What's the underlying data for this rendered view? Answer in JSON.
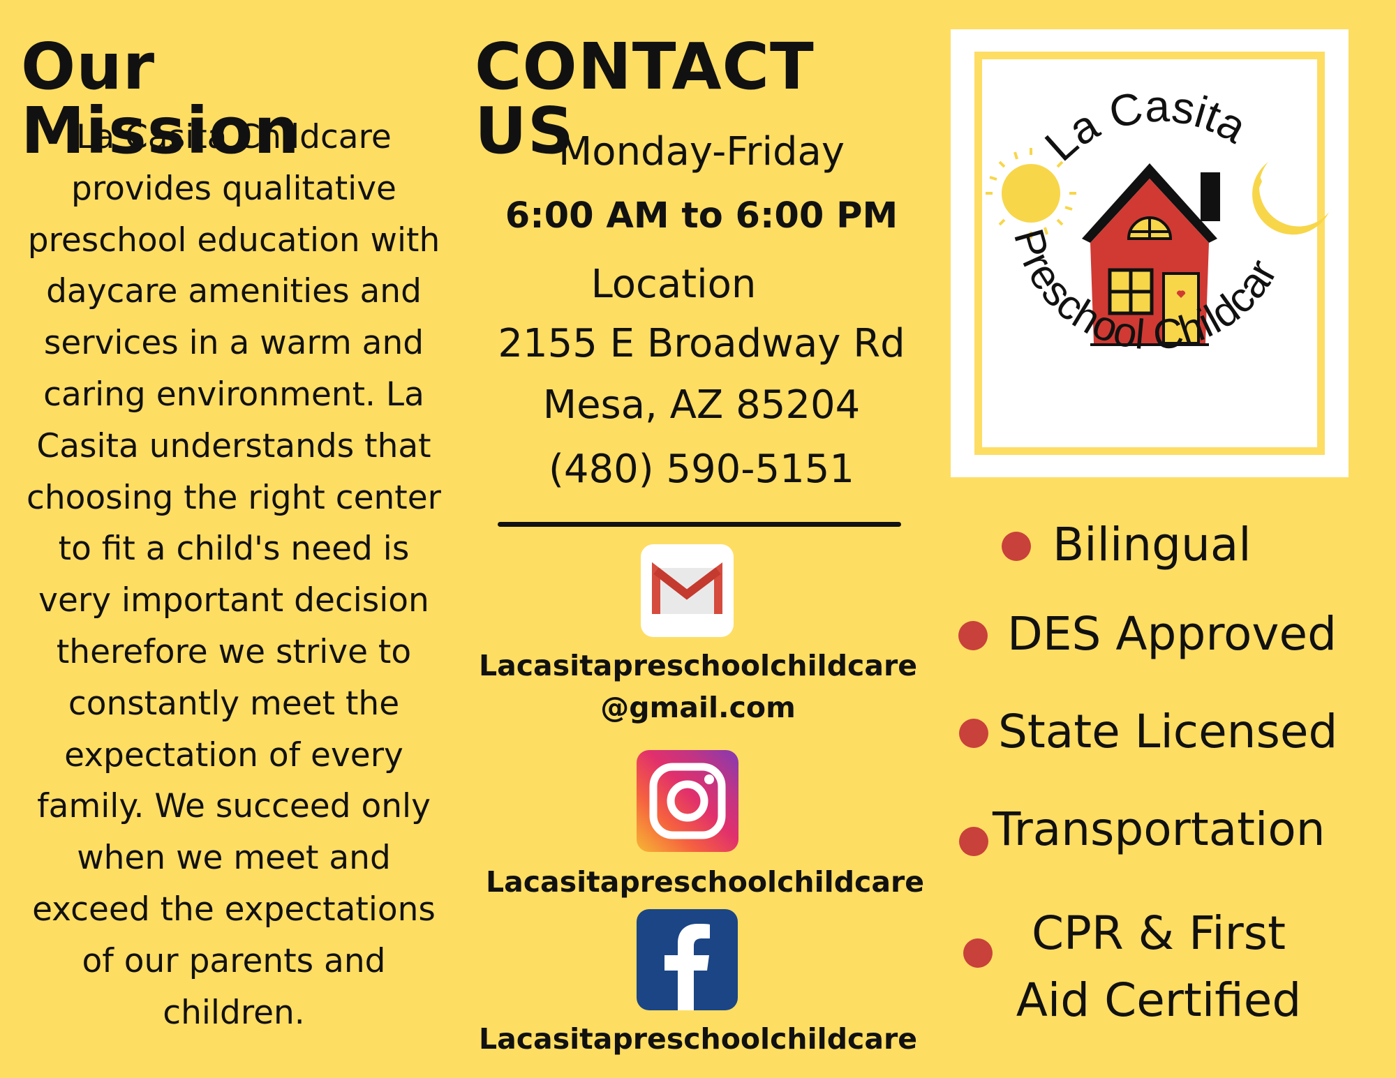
{
  "mission": {
    "title": "Our Mission",
    "lines": [
      "La Casita Childcare",
      "provides qualitative",
      "preschool education with",
      "daycare amenities and",
      "services in a warm and",
      "caring environment. La",
      "Casita understands that",
      "choosing the right center",
      "to fit a child's need is",
      "very important decision",
      "therefore we strive to",
      "constantly meet the",
      "expectation of every",
      "family. We succeed only",
      "when we meet and",
      "exceed the expectations",
      "of our parents and",
      "children."
    ]
  },
  "contact": {
    "title": "CONTACT US",
    "days": "Monday-Friday",
    "hours": "6:00 AM to 6:00 PM",
    "location_label": "Location",
    "address_line1": "2155 E Broadway Rd",
    "address_line2": "Mesa, AZ 85204",
    "phone": "(480) 590-5151",
    "email_line1": "Lacasitapreschoolchildcare",
    "email_line2": "@gmail.com",
    "instagram": "Lacasitapreschoolchildcare",
    "facebook": "Lacasitapreschoolchildcare"
  },
  "logo": {
    "top_text": "La Casita",
    "bottom_text": "Preschool Childcare"
  },
  "features": [
    "Bilingual",
    "DES Approved",
    "State Licensed",
    "Transportation",
    "CPR & First Aid Certified"
  ],
  "features_split": {
    "line1": "CPR & First",
    "line2": "Aid Certified"
  },
  "colors": {
    "background": "#fedd63",
    "bullet": "#c8413a",
    "house_red": "#d03a33",
    "facebook_blue": "#1b4585"
  },
  "icons": [
    "gmail-icon",
    "instagram-icon",
    "facebook-icon"
  ]
}
